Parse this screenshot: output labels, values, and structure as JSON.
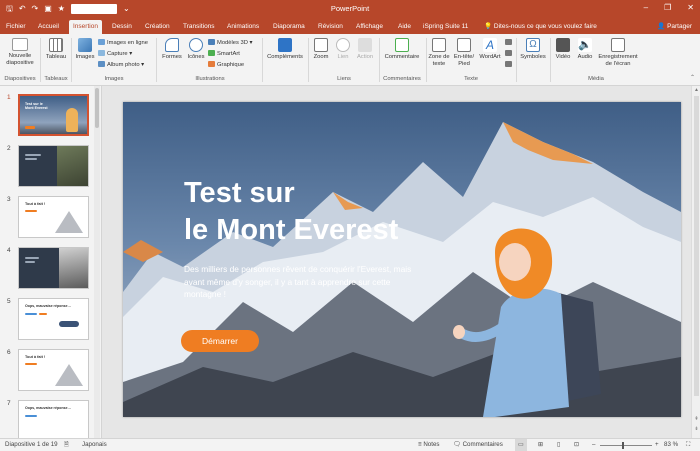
{
  "titlebar": {
    "app_title": "PowerPoint",
    "qat": {
      "save": "🖫",
      "undo": "↶",
      "redo": "↷",
      "slideshow": "▣",
      "star": "★",
      "more": "⌄"
    },
    "win": {
      "minimize": "–",
      "restore": "❐",
      "close": "✕"
    }
  },
  "tabs": {
    "items": [
      "Fichier",
      "Accueil",
      "Insertion",
      "Dessin",
      "Création",
      "Transitions",
      "Animations",
      "Diaporama",
      "Révision",
      "Affichage",
      "Aide",
      "iSpring Suite 11"
    ],
    "active": "Insertion",
    "tell_me": "Dites-nous ce que vous voulez faire",
    "share": "Partager"
  },
  "ribbon": {
    "nouvelle_diapo": "Nouvelle diapositive",
    "tableau": "Tableau",
    "images": "Images",
    "images_en_ligne": "Images en ligne",
    "capture": "Capture",
    "album_photo": "Album photo",
    "formes": "Formes",
    "icones": "Icônes",
    "modeles_3d": "Modèles 3D",
    "smartart": "SmartArt",
    "graphique": "Graphique",
    "complements": "Compléments",
    "zoom": "Zoom",
    "lien": "Lien",
    "action": "Action",
    "commentaire": "Commentaire",
    "zone_texte": "Zone de texte",
    "entete_pied": "En-tête/ Pied",
    "wordart": "WordArt",
    "symboles": "Symboles",
    "video": "Vidéo",
    "audio": "Audio",
    "enregistrement": "Enregistrement de l'écran",
    "groups": {
      "diapositives": "Diapositives",
      "tableaux": "Tableaux",
      "images": "Images",
      "illustrations": "Illustrations",
      "liens": "Liens",
      "commentaires": "Commentaires",
      "texte": "Texte",
      "media": "Média"
    }
  },
  "thumbnails": {
    "numbers": [
      "1",
      "2",
      "3",
      "4",
      "5",
      "6",
      "7"
    ],
    "t1_title": "Test sur le Mont Everest",
    "t3_title": "Tout à fait !",
    "t5_title": "Oops, mauvaise réponse…",
    "t6_title": "Tout à fait !",
    "t7_title": "Oops, mauvaise réponse…"
  },
  "slide": {
    "title_line1": "Test sur",
    "title_line2": "le Mont Everest",
    "body": "Des milliers de personnes rêvent de conquérir l'Everest, mais avant même d'y songer, il y a tant à apprendre sur cette montagne !",
    "cta": "Démarrer"
  },
  "statusbar": {
    "slide_info": "Diapositive 1 de 19",
    "language": "Japonais",
    "notes": "Notes",
    "comments": "Commentaires",
    "zoom_level": "83 %"
  },
  "colors": {
    "accent": "#b7472a",
    "cta": "#ef7d22",
    "selection": "#d35230"
  }
}
